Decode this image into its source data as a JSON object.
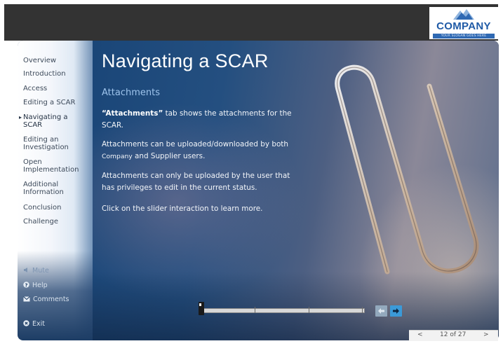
{
  "logo": {
    "name": "COMPANY",
    "slogan": "YOUR SLOGAN GOES HERE"
  },
  "sidebar": {
    "items": [
      {
        "label": "Overview"
      },
      {
        "label": "Introduction"
      },
      {
        "label": "Access"
      },
      {
        "label": "Editing a SCAR"
      },
      {
        "label_line1": "Navigating a",
        "label_line2": "SCAR",
        "active": true
      },
      {
        "label_line1": "Editing an",
        "label_line2": "Investigation"
      },
      {
        "label_line1": "Open",
        "label_line2": "Implementation"
      },
      {
        "label_line1": "Additional",
        "label_line2": "Information"
      },
      {
        "label": "Conclusion"
      },
      {
        "label": "Challenge"
      }
    ],
    "utilities": {
      "mute": "Mute",
      "help": "Help",
      "comments": "Comments",
      "exit": "Exit"
    }
  },
  "main": {
    "title": "Navigating a SCAR",
    "section": "Attachments",
    "paragraphs": {
      "p1_bold": "“Attachments”",
      "p1_rest": " tab shows the attachments for the SCAR.",
      "p2_a": "Attachments can be uploaded/downloaded by both ",
      "p2_company": "Company",
      "p2_b": " and Supplier users.",
      "p3": "Attachments can only be uploaded by the user that has privileges to edit in the current status.",
      "p4": "Click on the slider interaction to learn more."
    }
  },
  "slider": {
    "position": 0,
    "stops": 4
  },
  "pager": {
    "prev": "<",
    "text": "12 of 27",
    "next": ">"
  },
  "colors": {
    "accent_blue": "#1f5aa6",
    "section_title": "#9ec4ec",
    "next_button": "#3b9ad8"
  }
}
